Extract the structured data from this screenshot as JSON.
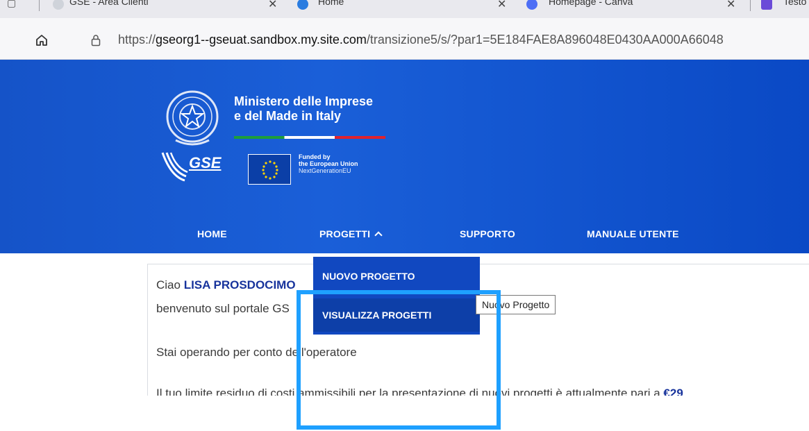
{
  "browser": {
    "tabs": [
      {
        "label": "GSE - Area Clienti"
      },
      {
        "label": "Home"
      },
      {
        "label": "Homepage - Canva"
      },
      {
        "label": "Testo"
      }
    ],
    "url_prefix": "https://",
    "url_host": "gseorg1--gseuat.sandbox.my.site.com",
    "url_path": "/transizione5/s/?par1=5E184FAE8A896048E0430AA000A66048"
  },
  "header": {
    "ministry_line1": "Ministero delle Imprese",
    "ministry_line2": "e del Made in Italy",
    "logo_text": "GSE",
    "eu_line1": "Funded by",
    "eu_line2": "the European Union",
    "eu_line3": "NextGenerationEU"
  },
  "nav": {
    "items": [
      {
        "label": "HOME"
      },
      {
        "label": "PROGETTI"
      },
      {
        "label": "SUPPORTO"
      },
      {
        "label": "MANUALE UTENTE"
      }
    ]
  },
  "dropdown": {
    "items": [
      {
        "label": "NUOVO PROGETTO"
      },
      {
        "label": "VISUALIZZA PROGETTI"
      }
    ],
    "tooltip": "Nuovo Progetto"
  },
  "content": {
    "greeting": "Ciao ",
    "user_name": "LISA PROSDOCIMO",
    "welcome": "benvenuto sul portale GS",
    "operator": "Stai operando per conto dell'operatore",
    "limit_text": "Il tuo limite residuo di costi ammissibili per la presentazione di nuovi progetti è attualmente pari a ",
    "limit_amount": "€29"
  },
  "colors": {
    "header_blue": "#1553c8",
    "dropdown_blue": "#1148c0",
    "user_blue": "#17339c",
    "highlight": "#1ea0ff"
  }
}
